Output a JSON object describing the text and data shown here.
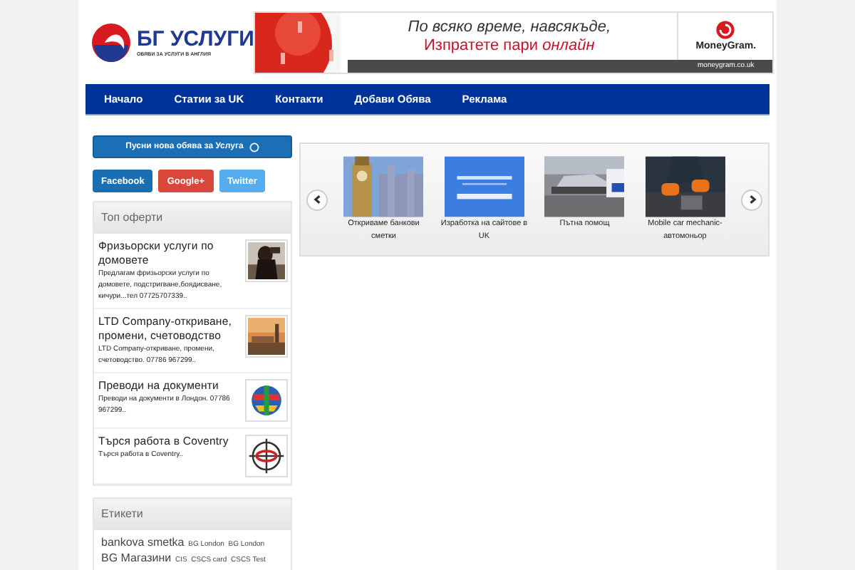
{
  "logo": {
    "title": "БГ УСЛУГИ",
    "subtitle": "ОБЯВИ ЗА УСЛУГИ В АНГЛИЯ"
  },
  "banner": {
    "line_1": "По всяко време, навсякъде,",
    "line_2": "Изпратете пари",
    "line_2_accent": "онлайн",
    "brand": "MoneyGram.",
    "url": "moneygram.co.uk"
  },
  "nav": [
    {
      "label": "Начало"
    },
    {
      "label": "Статии за UK"
    },
    {
      "label": "Контакти"
    },
    {
      "label": "Добави Обява"
    },
    {
      "label": "Реклама"
    }
  ],
  "post_button": "Пусни нова обява за Услуга",
  "social": [
    {
      "label": "Facebook",
      "color": "#1a6fb3"
    },
    {
      "label": "Google+",
      "color": "#d9473b"
    },
    {
      "label": "Twitter",
      "color": "#55acee"
    }
  ],
  "top_offers": {
    "title": "Топ оферти",
    "items": [
      {
        "title": "Фризьорски услуги по домовете",
        "text": "Предлагам фризьорски услуги по домовете, подстригване,боядисване, кичури...тел 07725707339.."
      },
      {
        "title": "LTD Company-откриване, промени, счетоводство",
        "text": "LTD Company-откриване, промени, счетоводство. 07786 967299.."
      },
      {
        "title": "Преводи на документи",
        "text": "Преводи на документи в Лондон. 07786 967299.."
      },
      {
        "title": "Търся работа в Coventry",
        "text": "Търся работа в Coventry.."
      }
    ]
  },
  "tags": {
    "title": "Етикети",
    "items": [
      {
        "label": "bankova smetka",
        "kind": "large"
      },
      {
        "label": "BG London",
        "kind": "small"
      },
      {
        "label": "BG London",
        "kind": "small"
      },
      {
        "label": "BG Магазини",
        "kind": "large"
      },
      {
        "label": "CIS",
        "kind": "small"
      },
      {
        "label": "CSCS card",
        "kind": "small"
      },
      {
        "label": "CSCS Test",
        "kind": "small"
      }
    ]
  },
  "slider": {
    "items": [
      {
        "caption": "Откриваме банкови сметки"
      },
      {
        "caption": "Изработка на сайтове в UK"
      },
      {
        "caption": "Пътна помощ"
      },
      {
        "caption": "Mobile car mechanic-автомоньор"
      }
    ]
  }
}
